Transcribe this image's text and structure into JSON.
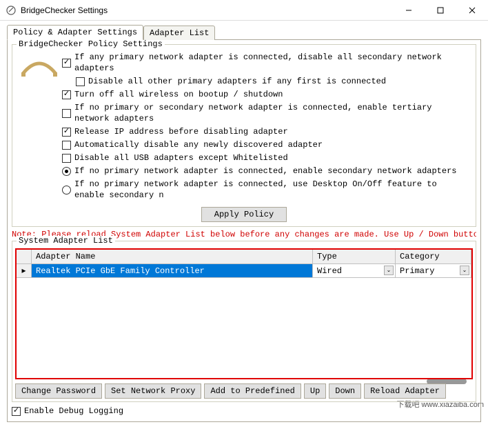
{
  "window": {
    "title": "BridgeChecker Settings"
  },
  "tabs": {
    "policy": "Policy & Adapter Settings",
    "adapter_list": "Adapter List"
  },
  "policy_group": {
    "legend": "BridgeChecker Policy Settings",
    "options": {
      "opt1": "If any primary network adapter is connected, disable all secondary network adapters",
      "opt1a": "Disable all other primary adapters if any first is connected",
      "opt2": "Turn off all wireless on bootup / shutdown",
      "opt3": "If no primary or secondary network adapter is connected, enable tertiary network adapters",
      "opt4": "Release IP address before disabling adapter",
      "opt5": "Automatically disable any newly discovered adapter",
      "opt6": "Disable all USB adapters except Whitelisted",
      "opt7": "If no primary network adapter is connected, enable secondary network adapters",
      "opt8": "If no primary network adapter is connected, use Desktop On/Off feature to enable secondary n"
    },
    "apply_label": "Apply Policy"
  },
  "note": "Note: Please reload System Adapter List below before any changes are made. Use Up / Down buttons to",
  "adapter_group": {
    "legend": "System Adapter List",
    "headers": {
      "name": "Adapter Name",
      "type": "Type",
      "category": "Category"
    },
    "rows": [
      {
        "name": "Realtek PCIe GbE Family Controller",
        "type": "Wired",
        "category": "Primary"
      }
    ]
  },
  "buttons": {
    "change_password": "Change Password",
    "set_proxy": "Set Network Proxy",
    "add_predefined": "Add to Predefined",
    "up": "Up",
    "down": "Down",
    "reload": "Reload Adapter"
  },
  "debug": {
    "label": "Enable Debug Logging"
  },
  "watermark": {
    "text": "下载吧",
    "url": "www.xiazaiba.com"
  }
}
